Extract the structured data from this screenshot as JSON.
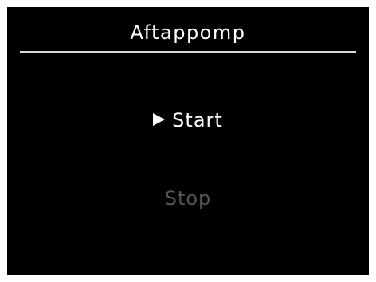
{
  "screen": {
    "title": "Aftappomp",
    "background": "#000000"
  },
  "menu": {
    "selected_index": 0,
    "cursor_icon": "triangle-right-icon",
    "items": [
      {
        "label": "Start",
        "state": "selected",
        "color": "#ffffff"
      },
      {
        "label": "Stop",
        "state": "disabled",
        "color": "#555555"
      }
    ]
  }
}
